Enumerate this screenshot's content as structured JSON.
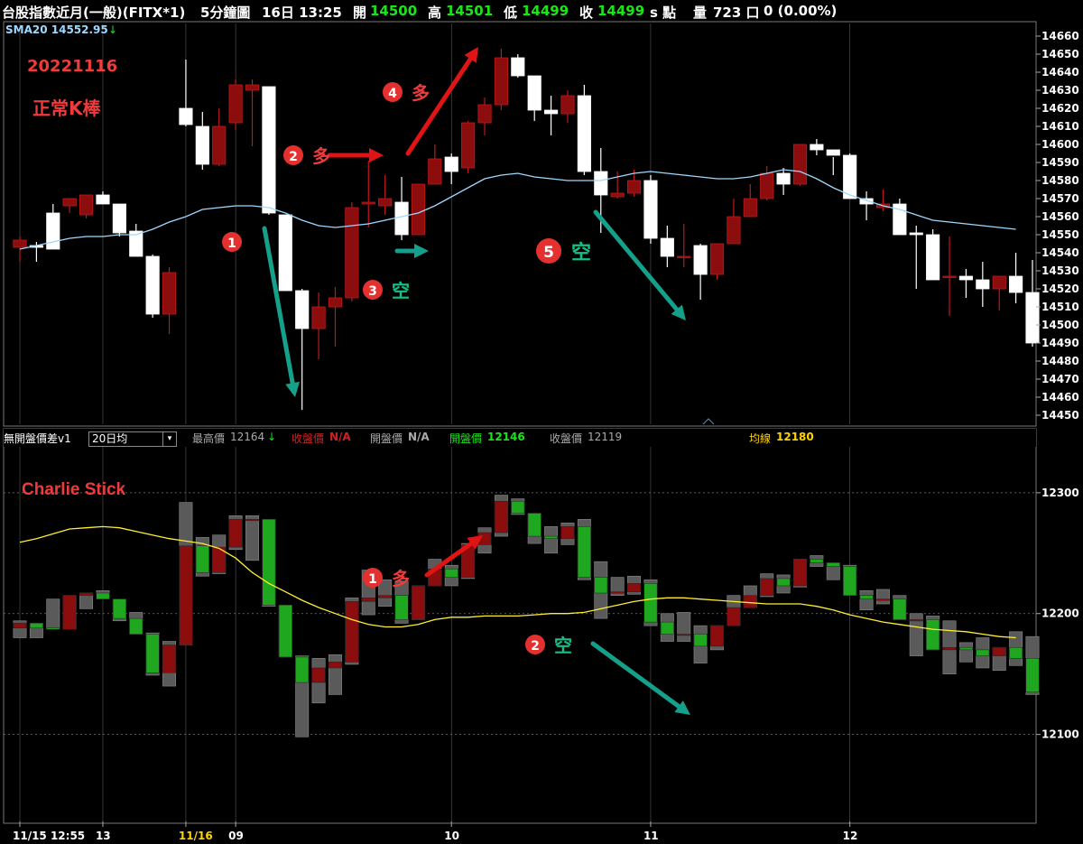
{
  "header": {
    "instrument": "台股指數近月(一般)(FITX*1)",
    "interval": "5分鐘圖",
    "datetime": "16日 13:25",
    "open_label": "開",
    "open": "14500",
    "high_label": "高",
    "high": "14501",
    "low_label": "低",
    "low": "14499",
    "close_label": "收",
    "close": "14499",
    "unit": "s 點",
    "volume_label": "量",
    "volume": "723 口",
    "change": "0 (0.00%)"
  },
  "main_indicator": {
    "label": "SMA20 14552.95",
    "arrow": "↓"
  },
  "annotations": {
    "date": "20221116",
    "subtitle": "正常K棒",
    "sub_title": "Charlie Stick",
    "steps": [
      {
        "num": "1",
        "text": ""
      },
      {
        "num": "2",
        "text": "多"
      },
      {
        "num": "3",
        "text": "空"
      },
      {
        "num": "4",
        "text": "多"
      },
      {
        "num": "5",
        "text": "空"
      }
    ],
    "sub_steps": [
      {
        "num": "1",
        "text": "多"
      },
      {
        "num": "2",
        "text": "空"
      }
    ]
  },
  "sub_header": {
    "name": "無開盤價差v1",
    "select_value": "20日均",
    "high_label": "最高價",
    "high": "12164",
    "high_arrow": "↓",
    "close_label": "收盤價",
    "close": "N/A",
    "open_label": "開盤價",
    "open": "N/A",
    "open2_label": "開盤價",
    "open2": "12146",
    "close2_label": "收盤價",
    "close2": "12119",
    "ma_label": "均線",
    "ma": "12180"
  },
  "colors": {
    "up": "#8b0d0d",
    "down": "#ffffff",
    "sma": "#9fd8ff",
    "sub_ma": "#ffee33",
    "sub_up": "#1fa81f",
    "sub_down": "#8b0d0d",
    "sub_gray": "#5a5a5a",
    "arrow_red": "#e01414",
    "arrow_teal": "#14a08a",
    "label_red": "#ef3b3b",
    "grid": "#5a5a5a"
  },
  "chart_data": [
    {
      "type": "candlestick",
      "title": "台股指數近月(一般)(FITX*1) 5分鐘圖",
      "ylim": [
        14445,
        14667
      ],
      "y_ticks": [
        14450,
        14460,
        14470,
        14480,
        14490,
        14500,
        14510,
        14520,
        14530,
        14540,
        14550,
        14560,
        14570,
        14580,
        14590,
        14600,
        14610,
        14620,
        14630,
        14640,
        14650,
        14660
      ],
      "x_labels": [
        "11/15 12:55",
        "13",
        "11/16",
        "09",
        "10",
        "11",
        "12"
      ],
      "x_label_index": [
        0,
        5,
        10,
        13,
        26,
        38,
        50
      ],
      "series_name": "SMA20",
      "candles": [
        {
          "o": 14543,
          "h": 14549,
          "l": 14535,
          "c": 14547
        },
        {
          "o": 14544,
          "h": 14546,
          "l": 14535,
          "c": 14543
        },
        {
          "o": 14562,
          "h": 14567,
          "l": 14542,
          "c": 14542
        },
        {
          "o": 14566,
          "h": 14570,
          "l": 14562,
          "c": 14570
        },
        {
          "o": 14561,
          "h": 14572,
          "l": 14559,
          "c": 14572
        },
        {
          "o": 14572,
          "h": 14574,
          "l": 14567,
          "c": 14567
        },
        {
          "o": 14567,
          "h": 14567,
          "l": 14549,
          "c": 14551
        },
        {
          "o": 14552,
          "h": 14556,
          "l": 14538,
          "c": 14538
        },
        {
          "o": 14538,
          "h": 14539,
          "l": 14504,
          "c": 14506
        },
        {
          "o": 14506,
          "h": 14532,
          "l": 14495,
          "c": 14529
        },
        {
          "o": 14620,
          "h": 14647,
          "l": 14610,
          "c": 14611
        },
        {
          "o": 14610,
          "h": 14618,
          "l": 14586,
          "c": 14589
        },
        {
          "o": 14589,
          "h": 14620,
          "l": 14588,
          "c": 14610
        },
        {
          "o": 14612,
          "h": 14636,
          "l": 14608,
          "c": 14633
        },
        {
          "o": 14630,
          "h": 14636,
          "l": 14599,
          "c": 14633
        },
        {
          "o": 14632,
          "h": 14632,
          "l": 14561,
          "c": 14562
        },
        {
          "o": 14561,
          "h": 14561,
          "l": 14519,
          "c": 14519
        },
        {
          "o": 14519,
          "h": 14520,
          "l": 14453,
          "c": 14498
        },
        {
          "o": 14498,
          "h": 14518,
          "l": 14481,
          "c": 14510
        },
        {
          "o": 14510,
          "h": 14521,
          "l": 14488,
          "c": 14515
        },
        {
          "o": 14515,
          "h": 14568,
          "l": 14513,
          "c": 14565
        },
        {
          "o": 14567,
          "h": 14591,
          "l": 14554,
          "c": 14568
        },
        {
          "o": 14566,
          "h": 14583,
          "l": 14561,
          "c": 14570
        },
        {
          "o": 14568,
          "h": 14582,
          "l": 14547,
          "c": 14550
        },
        {
          "o": 14550,
          "h": 14575,
          "l": 14550,
          "c": 14578
        },
        {
          "o": 14578,
          "h": 14600,
          "l": 14578,
          "c": 14592
        },
        {
          "o": 14593,
          "h": 14595,
          "l": 14578,
          "c": 14585
        },
        {
          "o": 14587,
          "h": 14613,
          "l": 14584,
          "c": 14612
        },
        {
          "o": 14612,
          "h": 14626,
          "l": 14605,
          "c": 14622
        },
        {
          "o": 14622,
          "h": 14653,
          "l": 14619,
          "c": 14648
        },
        {
          "o": 14648,
          "h": 14650,
          "l": 14637,
          "c": 14638
        },
        {
          "o": 14638,
          "h": 14637,
          "l": 14613,
          "c": 14619
        },
        {
          "o": 14619,
          "h": 14627,
          "l": 14605,
          "c": 14617
        },
        {
          "o": 14617,
          "h": 14630,
          "l": 14612,
          "c": 14627
        },
        {
          "o": 14627,
          "h": 14633,
          "l": 14583,
          "c": 14585
        },
        {
          "o": 14585,
          "h": 14598,
          "l": 14551,
          "c": 14572
        },
        {
          "o": 14571,
          "h": 14585,
          "l": 14570,
          "c": 14573
        },
        {
          "o": 14573,
          "h": 14586,
          "l": 14571,
          "c": 14580
        },
        {
          "o": 14580,
          "h": 14583,
          "l": 14545,
          "c": 14548
        },
        {
          "o": 14548,
          "h": 14555,
          "l": 14532,
          "c": 14538
        },
        {
          "o": 14538,
          "h": 14556,
          "l": 14532,
          "c": 14538
        },
        {
          "o": 14544,
          "h": 14545,
          "l": 14514,
          "c": 14528
        },
        {
          "o": 14528,
          "h": 14545,
          "l": 14525,
          "c": 14545
        },
        {
          "o": 14545,
          "h": 14570,
          "l": 14545,
          "c": 14560
        },
        {
          "o": 14560,
          "h": 14578,
          "l": 14560,
          "c": 14570
        },
        {
          "o": 14570,
          "h": 14588,
          "l": 14569,
          "c": 14584
        },
        {
          "o": 14584,
          "h": 14587,
          "l": 14572,
          "c": 14578
        },
        {
          "o": 14578,
          "h": 14600,
          "l": 14577,
          "c": 14600
        },
        {
          "o": 14600,
          "h": 14603,
          "l": 14594,
          "c": 14597
        },
        {
          "o": 14597,
          "h": 14593,
          "l": 14583,
          "c": 14594
        },
        {
          "o": 14594,
          "h": 14595,
          "l": 14570,
          "c": 14570
        },
        {
          "o": 14570,
          "h": 14574,
          "l": 14558,
          "c": 14567
        },
        {
          "o": 14565,
          "h": 14575,
          "l": 14563,
          "c": 14567
        },
        {
          "o": 14567,
          "h": 14570,
          "l": 14551,
          "c": 14550
        },
        {
          "o": 14551,
          "h": 14555,
          "l": 14520,
          "c": 14550
        },
        {
          "o": 14550,
          "h": 14553,
          "l": 14525,
          "c": 14525
        },
        {
          "o": 14527,
          "h": 14549,
          "l": 14505,
          "c": 14527
        },
        {
          "o": 14527,
          "h": 14531,
          "l": 14515,
          "c": 14525
        },
        {
          "o": 14525,
          "h": 14535,
          "l": 14510,
          "c": 14520
        },
        {
          "o": 14520,
          "h": 14522,
          "l": 14508,
          "c": 14527
        },
        {
          "o": 14527,
          "h": 14540,
          "l": 14512,
          "c": 14518
        },
        {
          "o": 14518,
          "h": 14536,
          "l": 14488,
          "c": 14490
        }
      ],
      "sma20": [
        14542,
        14544,
        14546,
        14548,
        14549,
        14549,
        14550,
        14550,
        14553,
        14557,
        14560,
        14564,
        14565,
        14566,
        14566,
        14565,
        14562,
        14558,
        14555,
        14554,
        14555,
        14556,
        14558,
        14560,
        14562,
        14566,
        14571,
        14576,
        14581,
        14583,
        14584,
        14582,
        14581,
        14580,
        14580,
        14580,
        14582,
        14584,
        14585,
        14584,
        14583,
        14582,
        14581,
        14581,
        14582,
        14584,
        14586,
        14585,
        14581,
        14576,
        14572,
        14569,
        14566,
        14564,
        14561,
        14558,
        14557,
        14556,
        14555,
        14554,
        14553
      ]
    },
    {
      "type": "candlestick",
      "title": "無開盤價差v1",
      "ylim": [
        12028,
        12338
      ],
      "y_ticks": [
        12100,
        12200,
        12300
      ],
      "series_name": "均線",
      "ma": [
        12259,
        12262,
        12266,
        12270,
        12271,
        12272,
        12271,
        12268,
        12265,
        12262,
        12260,
        12258,
        12254,
        12246,
        12234,
        12225,
        12218,
        12211,
        12205,
        12200,
        12195,
        12191,
        12189,
        12189,
        12191,
        12195,
        12197,
        12197,
        12198,
        12198,
        12198,
        12199,
        12200,
        12200,
        12201,
        12204,
        12207,
        12210,
        12212,
        12213,
        12213,
        12212,
        12211,
        12210,
        12209,
        12208,
        12208,
        12208,
        12206,
        12203,
        12199,
        12196,
        12193,
        12191,
        12189,
        12187,
        12186,
        12185,
        12183,
        12181,
        12180
      ]
    }
  ]
}
